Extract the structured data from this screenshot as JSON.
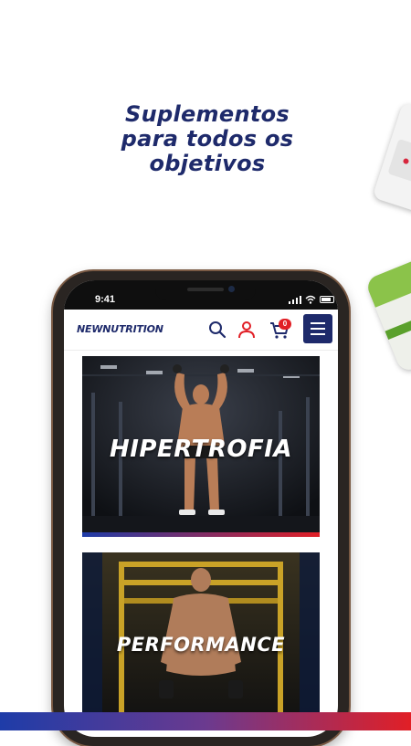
{
  "headline": {
    "line1": "Suplementos",
    "line2": "para todos os",
    "line3": "objetivos"
  },
  "phone": {
    "status": {
      "time": "9:41"
    },
    "app": {
      "brand": "NEWNUTRITION",
      "cart_count": "0",
      "icons": [
        "search-icon",
        "user-icon",
        "cart-icon",
        "menu-icon"
      ]
    },
    "categories": [
      {
        "label": "HIPERTROFIA"
      },
      {
        "label": "PERFORMANCE"
      }
    ]
  },
  "colors": {
    "brand_navy": "#1e2a6b",
    "accent_red": "#e11f26",
    "gradient_blue": "#1e3ca8"
  }
}
